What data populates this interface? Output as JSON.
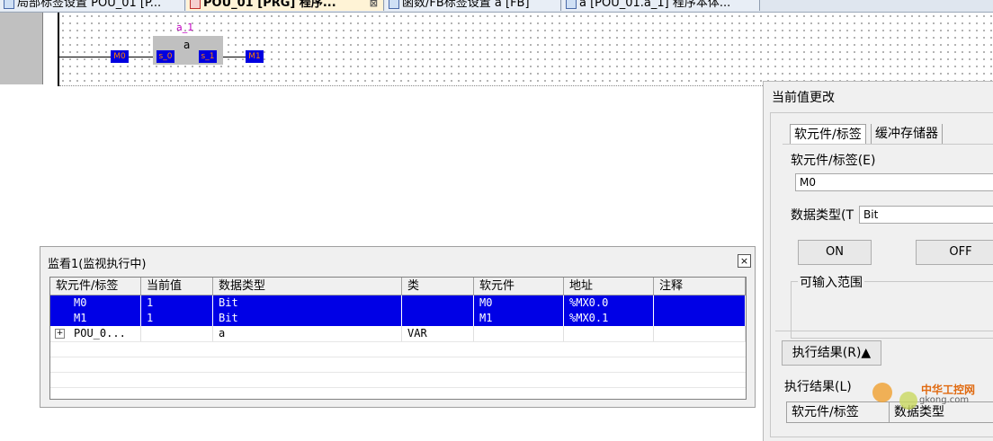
{
  "tabs": [
    {
      "label": "局部标签设置 POU_01 [P...",
      "active": false
    },
    {
      "label": "POU_01 [PRG] 程序...",
      "active": true,
      "close": "⊠"
    },
    {
      "label": "函数/FB标签设置 a [FB]",
      "active": false
    },
    {
      "label": "a [POU_01.a_1] 程序本体...",
      "active": false
    }
  ],
  "ladder": {
    "fb_instance": "a_1",
    "fb_type": "a",
    "input_contact": "M0",
    "output_coil": "M1",
    "pin_in": "s_0",
    "pin_out": "s_1"
  },
  "watch": {
    "title": "监看1(监视执行中)",
    "close_icon": "close-icon",
    "columns": [
      "软元件/标签",
      "当前值",
      "数据类型",
      "类",
      "软元件",
      "地址",
      "注释"
    ],
    "rows": [
      {
        "name": "M0",
        "value": "1",
        "type": "Bit",
        "class": "",
        "device": "M0",
        "address": "%MX0.0",
        "comment": "",
        "selected": true
      },
      {
        "name": "M1",
        "value": "1",
        "type": "Bit",
        "class": "",
        "device": "M1",
        "address": "%MX0.1",
        "comment": "",
        "selected": true
      },
      {
        "name": "POU_0...",
        "value": "",
        "type": "a",
        "class": "VAR",
        "device": "",
        "address": "",
        "comment": "",
        "selected": false,
        "expander": "⊞"
      }
    ]
  },
  "dialog": {
    "title": "当前值更改",
    "tabs": [
      "软元件/标签",
      "缓冲存储器"
    ],
    "device_label": "软元件/标签(E)",
    "device_value": "M0",
    "datatype_label": "数据类型(T",
    "datatype_value": "Bit",
    "on_button": "ON",
    "off_button": "OFF",
    "input_range_label": "可输入范围",
    "exec_result_button": "执行结果(R)▲",
    "exec_result_label": "执行结果(L)",
    "result_columns": [
      "软元件/标签",
      "数据类型"
    ]
  },
  "watermark": {
    "name": "中华工控网",
    "url": "gkong.com"
  },
  "colors": {
    "selection": "#0000e6",
    "fb_label": "#c000c0",
    "block_fill": "#0000e0"
  }
}
